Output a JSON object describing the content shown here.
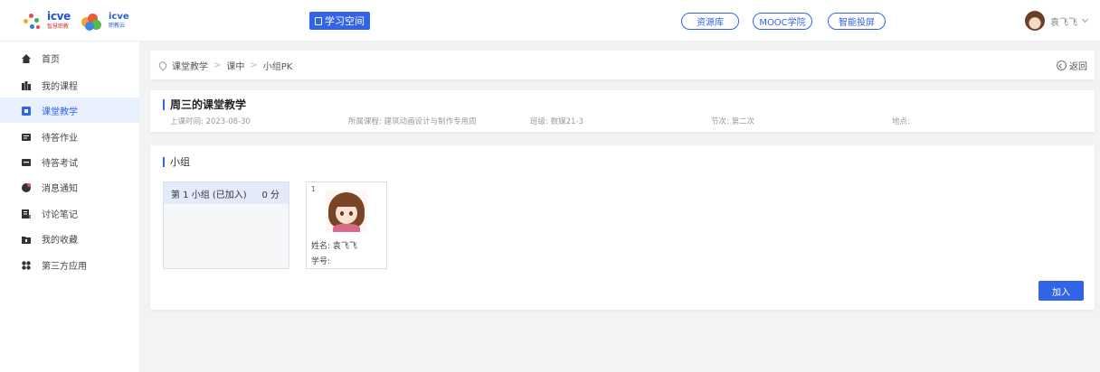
{
  "header": {
    "logo": {
      "brand1": "icve",
      "brand1_sub": "智慧职教",
      "brand2": "icve",
      "brand2_sub": "职教云"
    },
    "space_button": "学习空间",
    "links": [
      "资源库",
      "MOOC学院",
      "智能投屏"
    ],
    "user_name": "袁飞飞"
  },
  "sidebar": {
    "items": [
      {
        "label": "首页",
        "icon": "home-icon"
      },
      {
        "label": "我的课程",
        "icon": "courses-icon"
      },
      {
        "label": "课堂教学",
        "icon": "classroom-icon",
        "active": true
      },
      {
        "label": "待答作业",
        "icon": "homework-icon"
      },
      {
        "label": "待答考试",
        "icon": "exam-icon"
      },
      {
        "label": "消息通知",
        "icon": "message-icon"
      },
      {
        "label": "讨论笔记",
        "icon": "notes-icon"
      },
      {
        "label": "我的收藏",
        "icon": "favorites-icon"
      },
      {
        "label": "第三方应用",
        "icon": "apps-icon"
      }
    ]
  },
  "breadcrumb": {
    "items": [
      "课堂教学",
      "课中",
      "小组PK"
    ],
    "back_label": "返回"
  },
  "lesson": {
    "title": "周三的课堂教学",
    "time": "上课时间: 2023-08-30",
    "course": "所属课程: 建筑动画设计与制作专用周",
    "class": "班级: 数媒21-3",
    "session": "节次: 第二次",
    "place": "地点:"
  },
  "groups": {
    "section_title": "小组",
    "list": [
      {
        "name": "第 1 小组 (已加入)",
        "score": "0 分"
      }
    ],
    "member": {
      "index": "1",
      "name": "姓名: 袁飞飞",
      "student_id": "学号:"
    },
    "join_label": "加入"
  },
  "colors": {
    "primary": "#3264e8",
    "active_bg": "#e8effd"
  }
}
